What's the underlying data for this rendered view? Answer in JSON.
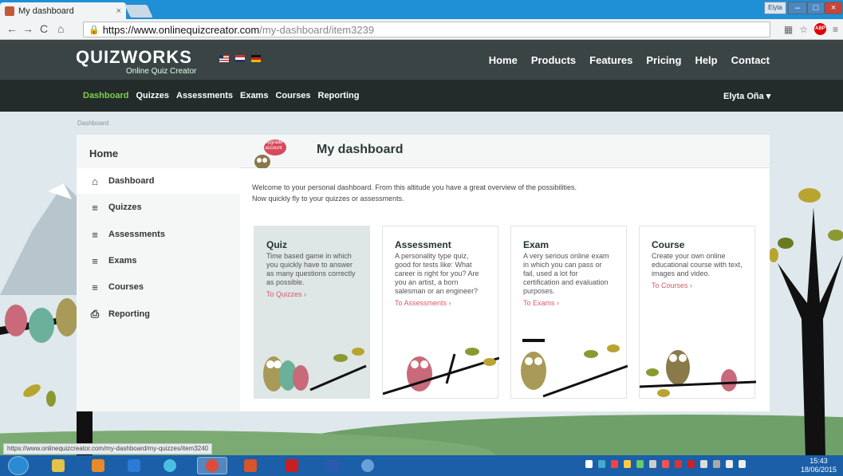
{
  "browser": {
    "tab_title": "My dashboard",
    "tab_close": "×",
    "url_host": "https://www.onlinequizcreator.com",
    "url_path": "/my-dashboard/item3239",
    "window_user_button": "Elyta"
  },
  "site": {
    "logo": "QUIZWORKS",
    "logo_sub": "Online Quiz Creator",
    "topnav": [
      "Home",
      "Products",
      "Features",
      "Pricing",
      "Help",
      "Contact"
    ],
    "subnav": [
      "Dashboard",
      "Quizzes",
      "Assessments",
      "Exams",
      "Courses",
      "Reporting"
    ],
    "user": "Elyta Oña ▾",
    "breadcrumb": "Dashboard"
  },
  "sidebar": {
    "title": "Home",
    "items": [
      {
        "label": "Dashboard",
        "icon": "home-icon"
      },
      {
        "label": "Quizzes",
        "icon": "menu-icon"
      },
      {
        "label": "Assessments",
        "icon": "menu-icon"
      },
      {
        "label": "Exams",
        "icon": "menu-icon"
      },
      {
        "label": "Courses",
        "icon": "menu-icon"
      },
      {
        "label": "Reporting",
        "icon": "reporting-icon"
      }
    ]
  },
  "main": {
    "upgrade_badge": "Upgrade account",
    "title": "My dashboard",
    "welcome_line1": "Welcome to your personal dashboard. From this altitude you have a great overview of the possibilities.",
    "welcome_line2": "Now quickly fly to your quizzes or assessments.",
    "cards": [
      {
        "title": "Quiz",
        "text": "Time based game in which you quickly have to answer as many questions correctly as possible.",
        "link": "To Quizzes ›"
      },
      {
        "title": "Assessment",
        "text": "A personality type quiz, good for tests like: What career is right for you? Are you an artist, a born salesman or an engineer?",
        "link": "To Assessments ›"
      },
      {
        "title": "Exam",
        "text": "A very serious online exam in which you can pass or fail, used a lot for certification and evaluation purposes.",
        "link": "To Exams ›"
      },
      {
        "title": "Course",
        "text": "Create your own online educational course with text, images and video.",
        "link": "To Courses ›"
      }
    ]
  },
  "status_url": "https://www.onlinequizcreator.com/my-dashboard/my-quizzes/item3240",
  "taskbar": {
    "time": "15:43",
    "date": "18/06/2015"
  },
  "colors": {
    "accent_green": "#7fd14a",
    "link_pink": "#d65a6a",
    "header_dark": "#3a4444"
  }
}
